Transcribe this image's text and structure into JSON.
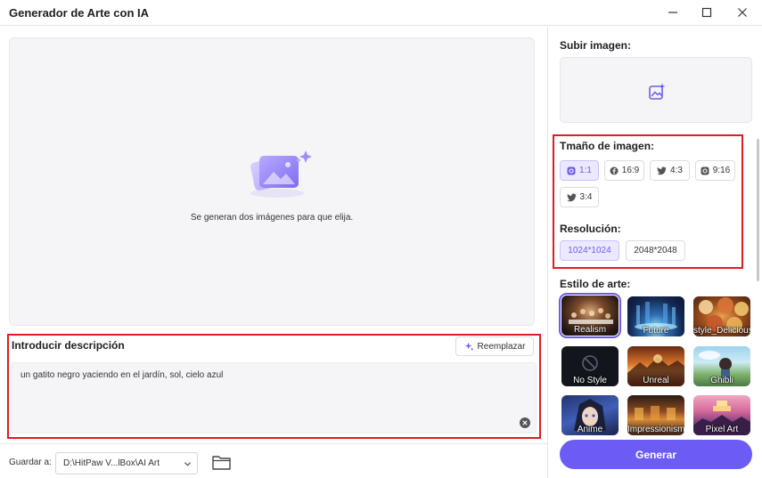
{
  "window": {
    "title": "Generador de Arte con IA"
  },
  "preview": {
    "message": "Se generan dos imágenes para que elija."
  },
  "description": {
    "title": "Introducir descripción",
    "replace_label": "Reemplazar",
    "text": "un gatito negro yaciendo en el jardín, sol, cielo azul"
  },
  "save": {
    "label": "Guardar a:",
    "path": "D:\\HitPaw V...lBox\\AI Art"
  },
  "upload": {
    "title": "Subir imagen:"
  },
  "size": {
    "title": "Tmaño de imagen:",
    "options": [
      {
        "label": "1:1",
        "icon": "instagram-icon",
        "active": true
      },
      {
        "label": "16:9",
        "icon": "facebook-icon",
        "active": false
      },
      {
        "label": "4:3",
        "icon": "twitter-icon",
        "active": false
      },
      {
        "label": "9:16",
        "icon": "instagram-icon",
        "active": false
      },
      {
        "label": "3:4",
        "icon": "twitter-icon",
        "active": false
      }
    ]
  },
  "resolution": {
    "title": "Resolución:",
    "options": [
      {
        "label": "1024*1024",
        "active": true
      },
      {
        "label": "2048*2048",
        "active": false
      }
    ]
  },
  "art_style": {
    "title": "Estilo de arte:",
    "styles": [
      {
        "label": "Realism",
        "selected": true
      },
      {
        "label": "Future",
        "selected": false
      },
      {
        "label": "style_Delicious",
        "selected": false
      },
      {
        "label": "No Style",
        "selected": false
      },
      {
        "label": "Unreal",
        "selected": false
      },
      {
        "label": "Ghibli",
        "selected": false
      },
      {
        "label": "Anime",
        "selected": false
      },
      {
        "label": "Impressionism",
        "selected": false
      },
      {
        "label": "Pixel Art",
        "selected": false
      }
    ]
  },
  "generate": {
    "label": "Generar"
  },
  "colors": {
    "accent": "#6c5cf5",
    "highlight_border": "#e01b24",
    "active_chip_bg": "#ece9ff"
  }
}
